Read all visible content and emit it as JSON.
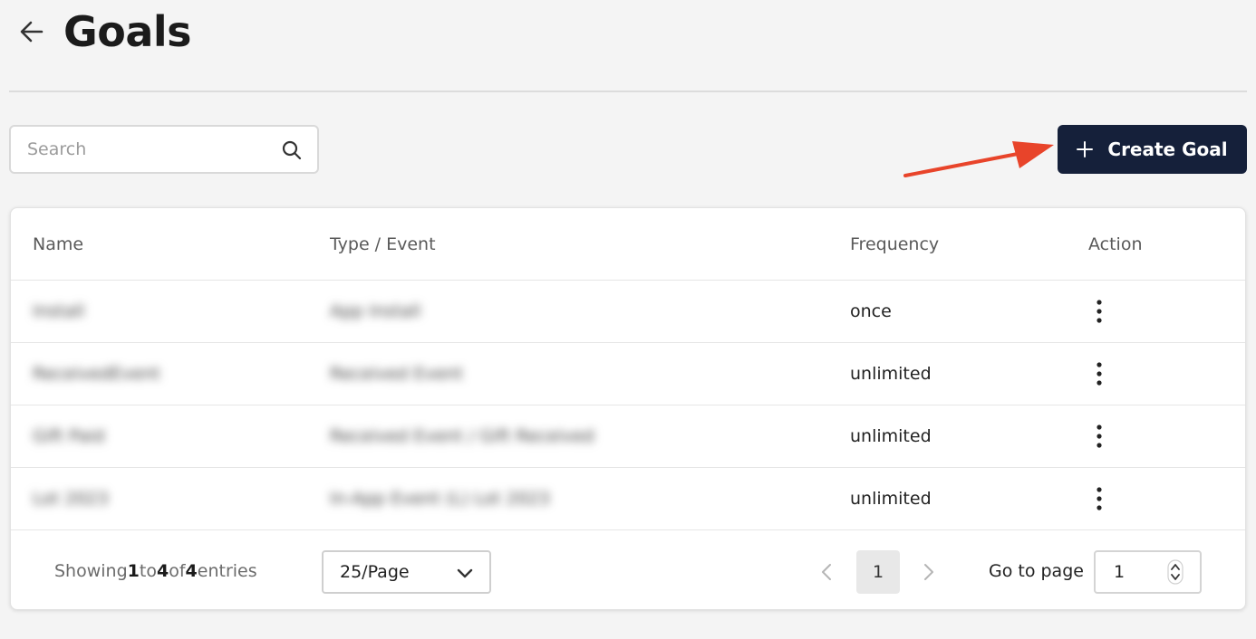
{
  "header": {
    "title": "Goals",
    "back_icon": "arrow-left-icon"
  },
  "toolbar": {
    "search_placeholder": "Search",
    "search_value": "",
    "search_icon": "search-icon",
    "create_label": "Create Goal",
    "create_icon": "plus-icon",
    "annotation_color": "#e8442a"
  },
  "table": {
    "columns": [
      "Name",
      "Type / Event",
      "Frequency",
      "Action"
    ],
    "rows": [
      {
        "name": "Install",
        "type": "App Install",
        "frequency": "once"
      },
      {
        "name": "ReceivedEvent",
        "type": "Received Event",
        "frequency": "unlimited"
      },
      {
        "name": "Gift Paid",
        "type": "Received Event / Gift Received",
        "frequency": "unlimited"
      },
      {
        "name": "Lot 2023",
        "type": "In-App Event (L) Lot 2023",
        "frequency": "unlimited"
      }
    ],
    "action_icon": "kebab-menu-icon",
    "blurred_columns": [
      "Name",
      "Type / Event"
    ]
  },
  "footer": {
    "showing_prefix": "Showing",
    "from": "1",
    "to_word": "to",
    "to": "4",
    "of_word": "of",
    "total": "4",
    "entries_word": "entries",
    "page_size": "25/Page",
    "current_page": "1",
    "goto_label": "Go to page",
    "goto_value": "1"
  },
  "colors": {
    "background": "#f4f4f4",
    "primary_button": "#15203a",
    "card": "#ffffff"
  }
}
